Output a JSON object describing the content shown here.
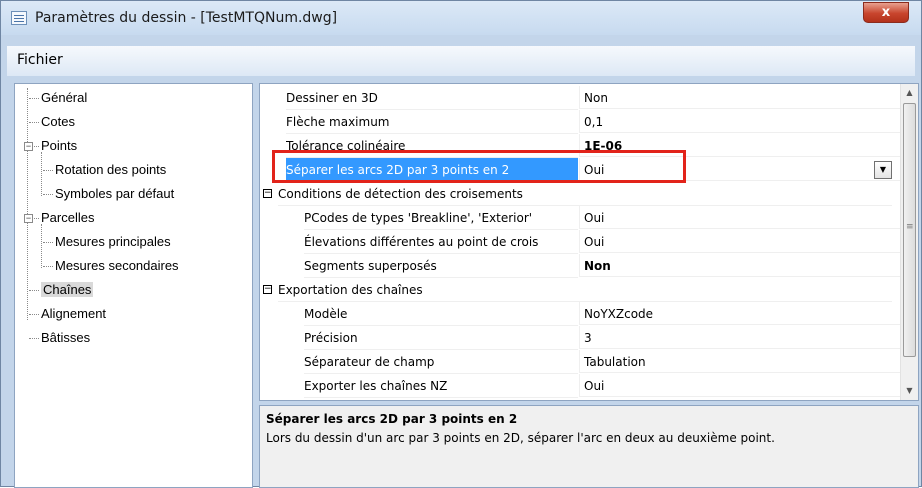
{
  "window": {
    "title": "Paramètres du dessin - [TestMTQNum.dwg]",
    "close_label": "x"
  },
  "menu": {
    "items": [
      "Fichier"
    ]
  },
  "tree": [
    {
      "label": "Général",
      "depth": 0
    },
    {
      "label": "Cotes",
      "depth": 0
    },
    {
      "label": "Points",
      "depth": 0,
      "expanded": true
    },
    {
      "label": "Rotation des points",
      "depth": 1
    },
    {
      "label": "Symboles par défaut",
      "depth": 1
    },
    {
      "label": "Parcelles",
      "depth": 0,
      "expanded": true
    },
    {
      "label": "Mesures principales",
      "depth": 1
    },
    {
      "label": "Mesures secondaires",
      "depth": 1
    },
    {
      "label": "Chaînes",
      "depth": 0,
      "selected": true
    },
    {
      "label": "Alignement",
      "depth": 0
    },
    {
      "label": "Bâtisses",
      "depth": 0
    }
  ],
  "properties": [
    {
      "name": "Dessiner en 3D",
      "value": "Non"
    },
    {
      "name": "Flèche maximum",
      "value": "0,1"
    },
    {
      "name": "Tolérance colinéaire",
      "value": "1E-06",
      "bold": true
    },
    {
      "name": "Séparer les arcs 2D par 3 points en 2",
      "value": "Oui",
      "selected": true,
      "dropdown": true
    },
    {
      "category": "Conditions de détection des croisements"
    },
    {
      "name": "PCodes de types 'Breakline', 'Exterior'",
      "value": "Oui",
      "sub": true
    },
    {
      "name": "Élevations différentes au point de crois",
      "value": "Oui",
      "sub": true
    },
    {
      "name": "Segments superposés",
      "value": "Non",
      "sub": true,
      "bold": true
    },
    {
      "category": "Exportation des chaînes"
    },
    {
      "name": "Modèle",
      "value": "NoYXZcode",
      "sub": true
    },
    {
      "name": "Précision",
      "value": "3",
      "sub": true
    },
    {
      "name": "Séparateur de champ",
      "value": "Tabulation",
      "sub": true
    },
    {
      "name": "Exporter les chaînes NZ",
      "value": "Oui",
      "sub": true
    }
  ],
  "description": {
    "title": "Séparer les arcs 2D par 3 points en 2",
    "text": "Lors du dessin d'un arc par 3 points en 2D, séparer l'arc en deux au deuxième point."
  },
  "icons": {
    "close": "close-icon",
    "dropdown": "chevron-down-icon",
    "expand": "minus-box-icon"
  },
  "colors": {
    "selection": "#3399ff",
    "highlight_box": "#e2231a",
    "close_button": "#c8452d"
  }
}
